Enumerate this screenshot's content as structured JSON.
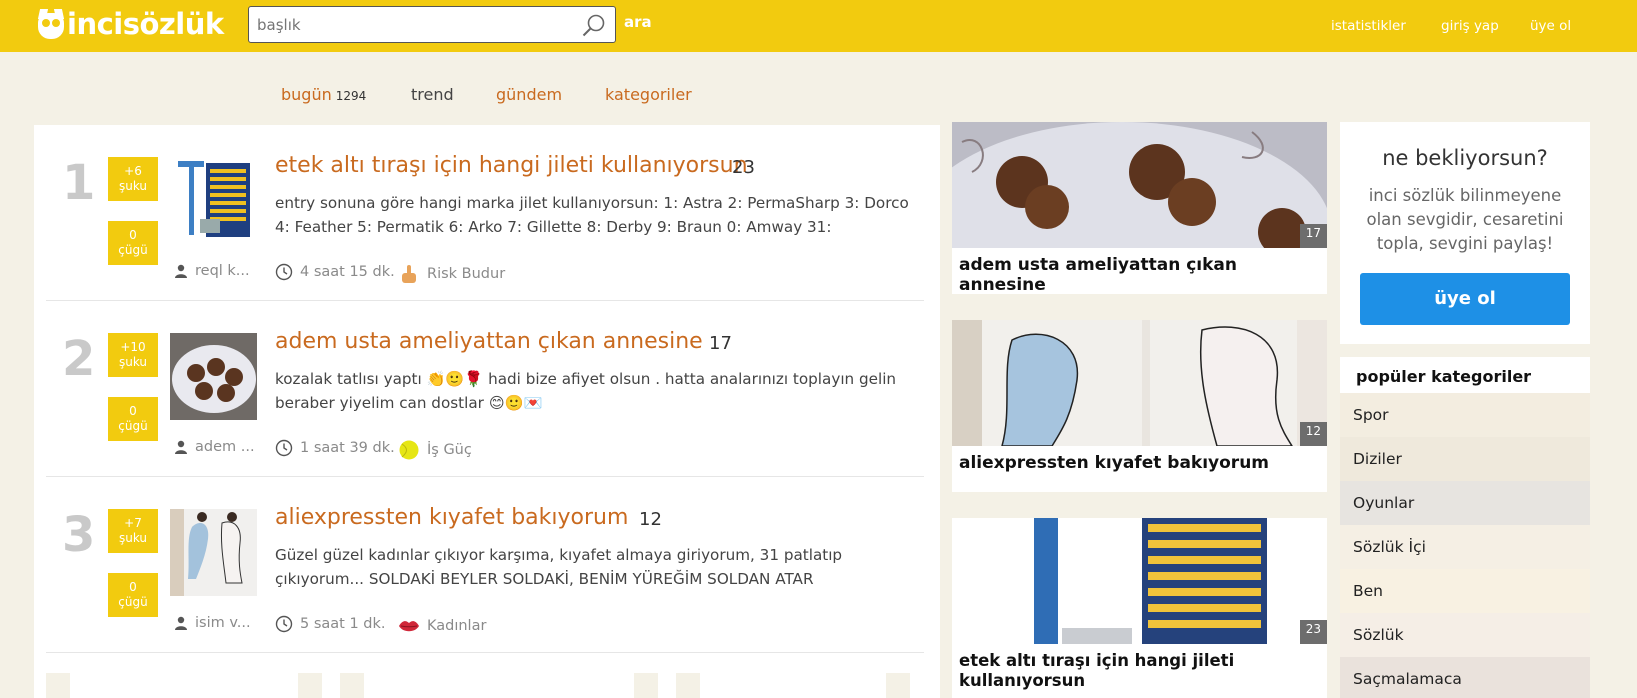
{
  "header": {
    "logo": "incisözlük",
    "search_placeholder": "başlık",
    "search_button": "ara",
    "nav": [
      "istatistikler",
      "giriş yap",
      "üye ol"
    ]
  },
  "subnav": {
    "today": "bugün",
    "today_count": "1294",
    "trend": "trend",
    "agenda": "gündem",
    "categories": "kategoriler"
  },
  "entries": [
    {
      "rank": "1",
      "up": "+6",
      "up_label": "şuku",
      "down": "0",
      "down_label": "çügü",
      "title": "etek altı tıraşı için hangi jileti kullanıyorsun",
      "count": "23",
      "text": "entry sonuna göre hangi marka jilet kullanıyorsun: 1: Astra 2: PermaSharp 3: Dorco 4: Feather 5: Permatik 6: Arko 7: Gillette 8: Derby 9: Braun 0: Amway 31:",
      "author": "reql k...",
      "time": "4 saat 15 dk.",
      "category": "Risk Budur"
    },
    {
      "rank": "2",
      "up": "+10",
      "up_label": "şuku",
      "down": "0",
      "down_label": "çügü",
      "title": "adem usta ameliyattan çıkan annesine",
      "count": "17",
      "text": "kozalak tatlısı yaptı 👏🙂🌹 hadi bize afiyet olsun . hatta analarınızı toplayın gelin beraber yiyelim can dostlar 😊🙂💌",
      "author": "adem ...",
      "time": "1 saat 39 dk.",
      "category": "İş Güç"
    },
    {
      "rank": "3",
      "up": "+7",
      "up_label": "şuku",
      "down": "0",
      "down_label": "çügü",
      "title": "aliexpressten kıyafet bakıyorum",
      "count": "12",
      "text": "Güzel güzel kadınlar çıkıyor karşıma, kıyafet almaya giriyorum, 31 patlatıp çıkıyorum... SOLDAKİ BEYLER SOLDAKİ, BENİM YÜREĞİM SOLDAN ATAR",
      "author": "isim v...",
      "time": "5 saat 1 dk.",
      "category": "Kadınlar"
    }
  ],
  "cards": [
    {
      "title": "adem usta ameliyattan çıkan annesine",
      "count": "17"
    },
    {
      "title": "aliexpressten kıyafet bakıyorum",
      "count": "12"
    },
    {
      "title": "etek altı tıraşı için hangi jileti kullanıyorsun",
      "count": "23"
    }
  ],
  "sidebar": {
    "heading": "ne bekliyorsun?",
    "text": "inci sözlük bilinmeyene olan sevgidir, cesaretini topla, sevgini paylaş!",
    "button": "üye ol",
    "categories_heading": "popüler kategoriler",
    "categories": [
      "Spor",
      "Diziler",
      "Oyunlar",
      "Sözlük İçi",
      "Ben",
      "Sözlük",
      "Saçmalamaca"
    ]
  },
  "colors": {
    "brand_yellow": "#f2cb0f",
    "title_orange": "#c96a1f",
    "button_blue": "#1e90e6"
  }
}
